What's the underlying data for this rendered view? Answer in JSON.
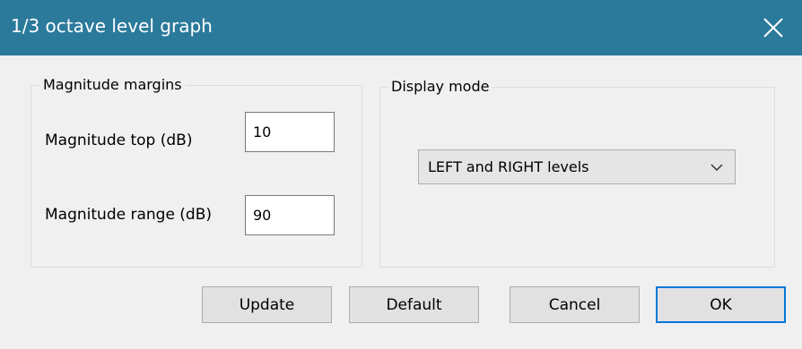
{
  "window": {
    "title": "1/3 octave level graph"
  },
  "margins_group": {
    "legend": "Magnitude margins",
    "top_label": "Magnitude top (dB)",
    "top_value": "10",
    "range_label": "Magnitude range (dB)",
    "range_value": "90"
  },
  "display_group": {
    "legend": "Display mode",
    "selected": "LEFT and RIGHT levels"
  },
  "buttons": {
    "update": "Update",
    "default": "Default",
    "cancel": "Cancel",
    "ok": "OK"
  },
  "colors": {
    "titlebar": "#2b7a9b",
    "dialog_bg": "#f0f0f0",
    "focus_border": "#0078d7"
  }
}
